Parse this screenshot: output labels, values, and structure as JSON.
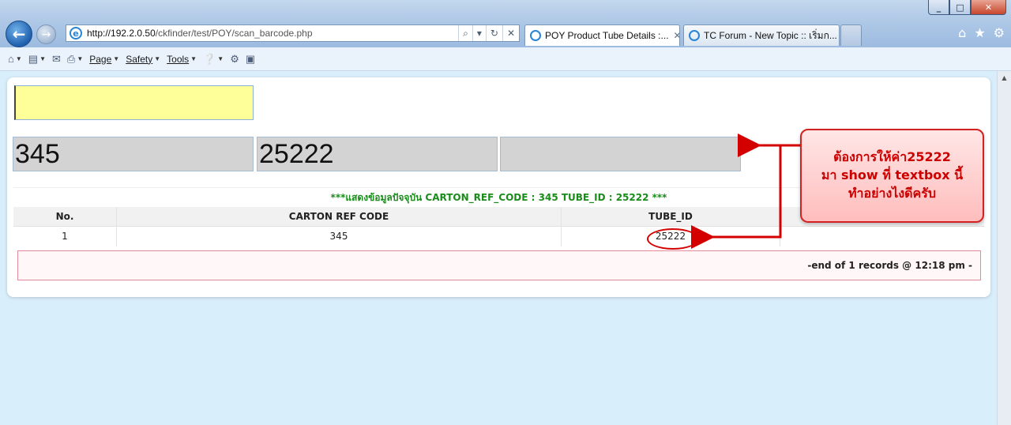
{
  "browser": {
    "url_host": "http://192.2.0.50",
    "url_path": "/ckfinder/test/POY/scan_barcode.php",
    "tabs": [
      {
        "title": "POY Product Tube Details :...",
        "active": true
      },
      {
        "title": "TC Forum - New Topic :: เริ่มก...",
        "active": false
      }
    ],
    "window_buttons": {
      "minimize": "_",
      "maximize": "□",
      "close": "✕"
    },
    "address_controls": {
      "search": "⌕",
      "dropdown": "▾",
      "refresh": "↻",
      "stop": "✕"
    }
  },
  "commandbar": {
    "page_label": "Page",
    "safety_label": "Safety",
    "tools_label": "Tools"
  },
  "form": {
    "scan_value": "",
    "carton_ref_value": "345",
    "tube_id_value": "25222",
    "third_value": ""
  },
  "table": {
    "caption": "***แสดงข้อมูลปัจจุบัน CARTON_REF_CODE : 345 TUBE_ID : 25222 ***",
    "headers": [
      "No.",
      "CARTON REF CODE",
      "TUBE_ID"
    ],
    "rows": [
      [
        "1",
        "345",
        "25222"
      ]
    ],
    "footer": "-end of 1 records @ 12:18 pm -"
  },
  "annotation": {
    "line1": "ต้องการให้ค่า25222",
    "line2": "มา show ที่ textbox นี้",
    "line3": "ทำอย่างไงดีครับ",
    "color": "#d40000"
  }
}
